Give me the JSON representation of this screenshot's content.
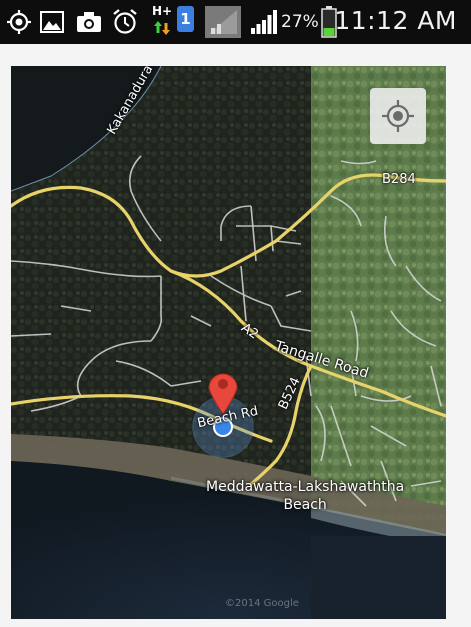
{
  "status_bar": {
    "time": "11:12 AM",
    "battery_percent": "27%",
    "network_type": "H+",
    "sim_slot": "1",
    "icons": [
      "location-icon",
      "gallery-icon",
      "camera-icon",
      "alarm-icon",
      "data-arrows-icon",
      "signal-weak-icon",
      "signal-icon",
      "battery-icon"
    ]
  },
  "map": {
    "road_labels": {
      "kakanadura": "Kakanadura Rd",
      "b284": "B284",
      "a2": "A2",
      "tangalle": "Tangalle Road",
      "b524": "B524",
      "beach_rd": "Beach Rd"
    },
    "poi_label": {
      "line1": "Meddawatta-Lakshawaththa",
      "line2": "Beach"
    },
    "copyright": "©2014 Google",
    "colors": {
      "main_road": "#e8d36a",
      "minor_road": "#d9d9d9",
      "marker": "#e8483c",
      "location_dot": "#3a86e8",
      "accuracy_circle": "#5a8fcf"
    },
    "controls": {
      "my_location_icon": "crosshair-icon"
    }
  }
}
